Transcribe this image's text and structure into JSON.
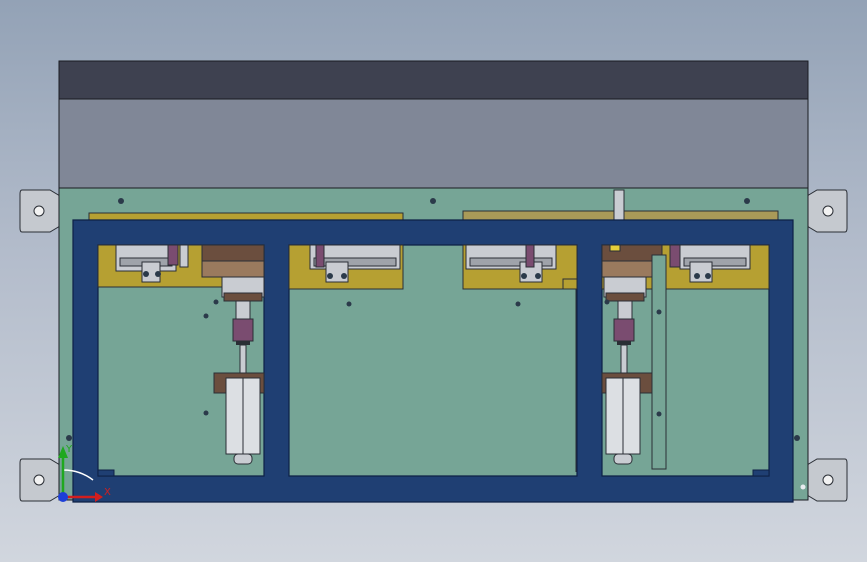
{
  "viewport": {
    "background_top": "#93a2b6",
    "background_bottom": "#d1d6de",
    "model_type": "assembly-front-view"
  },
  "colors": {
    "frame_blue": "#1f3f73",
    "frame_blue_edge": "#0d2046",
    "back_plate_green": "#76a596",
    "top_cover_dark": "#3e4150",
    "top_cover_grey": "#808797",
    "bracket_yellow": "#b6a032",
    "slide_grey": "#c9ccd2",
    "cylinder_purple": "#7a4c70",
    "rail_brown": "#6b4e3e",
    "mounting_tab": "#c5c9cf"
  },
  "triad": {
    "axis_x": "X",
    "axis_y": "Y",
    "color_x": "#d21e1e",
    "color_y": "#1fa81f",
    "color_z": "#1d3fd8"
  }
}
